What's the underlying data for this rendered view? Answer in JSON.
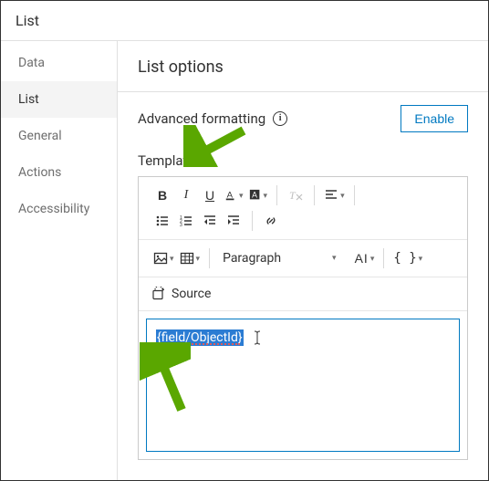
{
  "window": {
    "title": "List"
  },
  "sidebar": {
    "items": [
      {
        "label": "Data"
      },
      {
        "label": "List"
      },
      {
        "label": "General"
      },
      {
        "label": "Actions"
      },
      {
        "label": "Accessibility"
      }
    ],
    "active_index": 1
  },
  "content": {
    "title": "List options",
    "advanced_row": {
      "label": "Advanced formatting",
      "enable": "Enable"
    },
    "template_label": "Template",
    "toolbar": {
      "bold": "B",
      "italic": "I",
      "underline": "U",
      "paragraph": "Paragraph",
      "ai": "AI",
      "braces": "{ }",
      "source": "Source"
    },
    "editor": {
      "selected_text": "{field/ObjectId}"
    }
  },
  "colors": {
    "accent": "#0079c1",
    "arrow": "#5aa700",
    "selection": "#2b7cd3"
  }
}
